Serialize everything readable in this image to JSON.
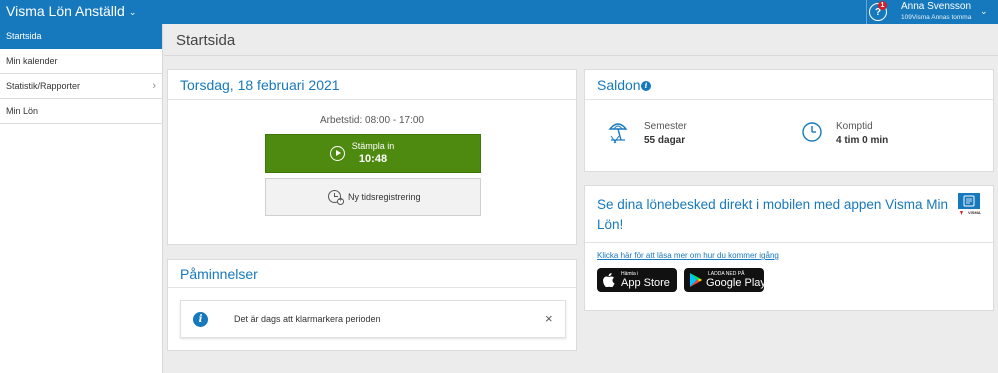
{
  "topbar": {
    "app_title": "Visma Lön Anställd",
    "notification_count": "1",
    "help_glyph": "?",
    "user_name": "Anna Svensson",
    "user_org": "109Visma Annas tomma",
    "accent_color": "#1779bd",
    "icons": [
      "chevron-down-icon",
      "help-icon",
      "chevron-down-icon"
    ]
  },
  "sidebar": {
    "items": [
      {
        "label": "Startsida",
        "active": true
      },
      {
        "label": "Min kalender",
        "active": false
      },
      {
        "label": "Statistik/Rapporter",
        "active": false,
        "has_submenu": true
      },
      {
        "label": "Min Lön",
        "active": false
      }
    ]
  },
  "main": {
    "page_title": "Startsida",
    "today_card": {
      "date": "Torsdag, 18 februari 2021",
      "work_hours": "Arbetstid: 08:00 - 17:00",
      "stamp_label": "Stämpla in",
      "stamp_time": "10:48",
      "new_entry_label": "Ny tidsregistrering",
      "stamp_color": "#4e8a10"
    },
    "reminders_card": {
      "title": "Påminnelser",
      "items": [
        {
          "text": "Det är dags att klarmarkera perioden"
        }
      ]
    },
    "balances_card": {
      "title": "Saldon",
      "items": [
        {
          "label": "Semester",
          "value": "55 dagar",
          "icon": "beach-umbrella-icon"
        },
        {
          "label": "Komptid",
          "value": "4 tim 0 min",
          "icon": "clock-icon"
        }
      ]
    },
    "promo_card": {
      "title": "Se dina lönebesked direkt i mobilen med appen Visma Min Lön!",
      "link": "Klicka här för att läsa mer om hur du kommer igång",
      "logo_text": "VISMA",
      "app_store": {
        "small": "Hämta i",
        "big": "App Store"
      },
      "google_play": {
        "small": "LADDA NED PÅ",
        "big": "Google Play"
      }
    }
  }
}
